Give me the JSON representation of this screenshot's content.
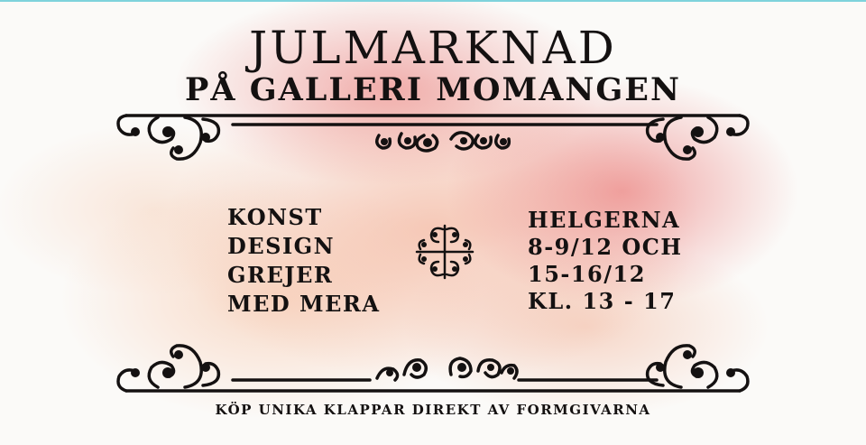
{
  "poster": {
    "title": "JULMARKNAD",
    "subtitle": "PÅ GALLERI MOMANGEN",
    "left_items": [
      "KONST",
      "DESIGN",
      "GREJER",
      "MED MERA"
    ],
    "right_items": [
      "HELGERNA",
      "8-9/12 OCH",
      "15-16/12",
      "KL. 13 - 17"
    ],
    "footer": "KÖP UNIKA KLAPPAR DIREKT AV FORMGIVARNA"
  },
  "colors": {
    "ink": "#141111",
    "watercolor": "#e8706e",
    "background": "#fbfaf8",
    "top_border": "#7fd3dc"
  }
}
